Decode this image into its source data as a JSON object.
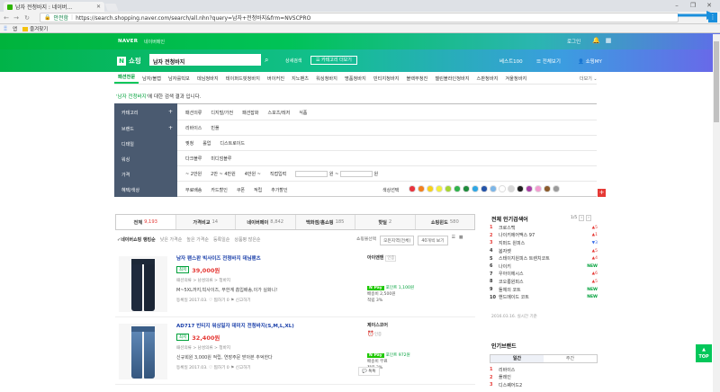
{
  "browser": {
    "tab_title": "남자 전청바지 : 네이버...",
    "secure_label": "안전함",
    "url": "https://search.shopping.naver.com/search/all.nhn?query=남자+전청바지&frm=NVSCPRO",
    "bookmarks": [
      "앱",
      "즐겨찾기"
    ]
  },
  "naver_gnb": {
    "logo": "NAVER",
    "sub": "네이버메인",
    "login": "로그인"
  },
  "shopping_header": {
    "logo": "쇼핑",
    "search_value": "남자 전청바지",
    "detail_search": "상세검색",
    "category_more": "카테고리 더보기",
    "best100": "베스트100",
    "full_view": "전체보기",
    "my_shop": "쇼핑MY"
  },
  "category_nav": {
    "items": [
      "패션전문",
      "남자/볼캡",
      "남자를빅모",
      "데님청바지",
      "테이퍼드핏청바지",
      "버이커진",
      "지노팬츠",
      "워싱청바지",
      "명품청바지",
      "빈티지청바지",
      "블랙무청진",
      "젤린블라인청바지",
      "스판청바지",
      "겨울청바지"
    ],
    "more": "더보기"
  },
  "result_line": {
    "keyword": "'남자 전청바지'",
    "rest": "에 대한 검색 결과 입니다."
  },
  "filter": {
    "labels": [
      "카테고리",
      "브랜드",
      "디테일",
      "워싱",
      "가격",
      "혜택/색상"
    ],
    "rows": [
      [
        "패션의류",
        "디지털/가전",
        "패션잡화",
        "스포츠/레저",
        "식품"
      ],
      [
        "리바이스",
        "빈폴"
      ],
      [
        "찢청",
        "롤업",
        "디스트로이드"
      ],
      [
        "다크블루",
        "미디엄블루"
      ],
      [
        "~ 2만원",
        "2만 ~ 4만원",
        "4만원 ~",
        "직접입력"
      ],
      [
        "무료배송",
        "카드할인",
        "쿠폰",
        "적립",
        "추가할인"
      ]
    ],
    "price_won": "원",
    "color_label": "색상선택",
    "colors": [
      "#e8333e",
      "#f2801f",
      "#f7d01b",
      "#f3ef3a",
      "#a6d531",
      "#2fb24b",
      "#1e8b3b",
      "#2fa7e4",
      "#2453a8",
      "#7cb6e8",
      "#ffffff",
      "#d7d7d7",
      "#1f1f1f",
      "#a93fa6",
      "#f39bd0",
      "#8b5a2b",
      "#9b9b9b"
    ]
  },
  "sort_tabs": [
    {
      "label": "전체",
      "count": "9,193"
    },
    {
      "label": "가격비교",
      "count": "14"
    },
    {
      "label": "네이버페이",
      "count": "8,842"
    },
    {
      "label": "백화점/홈쇼핑",
      "count": "185"
    },
    {
      "label": "핫딜",
      "count": "2"
    },
    {
      "label": "쇼핑윈도",
      "count": "580"
    }
  ],
  "sort_options": [
    "네이버쇼핑 랭킹순",
    "낮은 가격순",
    "높은 가격순",
    "등록일순",
    "상품평 많은순"
  ],
  "view_options": [
    "쇼핑몰선택",
    "모든지역(전체)",
    "40개씩 보기"
  ],
  "products": [
    {
      "title": "남자 팬스판 빅사이즈 전청바지 데님팬츠",
      "price_tag": "최저",
      "price": "39,000원",
      "category": "패션의류 > 남성의류 > 청바지",
      "desc": "M~5XL까지,빅사이즈, 무한계 흡입배송,이가 실화니!",
      "meta": "등록일 2017.03.   ♡ 찜하기 0   ⚑ 신고하기",
      "seller": "아이앤맨",
      "grade": "인증",
      "npay_text": "포인트 1,100원",
      "npay_sub": "배송비 2,500원",
      "accrual": "적립 3%"
    },
    {
      "title": "AD717 빈티지 워싱일자 데미지 전청바지(S,M,L,XL)",
      "price_tag": "최저",
      "price": "32,400원",
      "category": "패션의류 > 남성의류 > 청바지",
      "desc": "신규회원 3,000원 적립, 연장주문 받아본 추억한다",
      "meta": "등록일 2017.03.   ♡ 찜하기 0   ⚑ 신고하기",
      "seller": "제이스코어",
      "grade": "인증",
      "npay_text": "포인트 972원",
      "npay_sub": "배송비 무료",
      "accrual": "적립 3%",
      "talk": "톡톡"
    }
  ],
  "popular_search": {
    "title": "전체 인기검색어",
    "pager": "1/5",
    "date": "2016.03.16. 실시간 기준",
    "items": [
      {
        "rank": "1",
        "name": "크로스백",
        "change": "▲5"
      },
      {
        "rank": "2",
        "name": "나이키에어맥스 97",
        "change": "▲1"
      },
      {
        "rank": "3",
        "name": "지퍼드 원피스",
        "change": "▼3"
      },
      {
        "rank": "4",
        "name": "봄자켓",
        "change": "▲5"
      },
      {
        "rank": "5",
        "name": "스테이지원피스 트렌치코트",
        "change": "▲4"
      },
      {
        "rank": "6",
        "name": "나이키",
        "change": "NEW"
      },
      {
        "rank": "7",
        "name": "우아이에시스",
        "change": "▲6"
      },
      {
        "rank": "8",
        "name": "코오롱원피스",
        "change": "▲5"
      },
      {
        "rank": "9",
        "name": "돌체의 코트",
        "change": "NEW"
      },
      {
        "rank": "10",
        "name": "핸드메이드 코트",
        "change": "NEW"
      }
    ]
  },
  "popular_brand": {
    "title": "인기브랜드",
    "tabs": [
      "일간",
      "주간"
    ],
    "items": [
      {
        "rank": "1",
        "name": "리바이스"
      },
      {
        "rank": "2",
        "name": "플레인"
      },
      {
        "rank": "3",
        "name": "디스퀘어드2"
      }
    ]
  },
  "top_button": "TOP"
}
